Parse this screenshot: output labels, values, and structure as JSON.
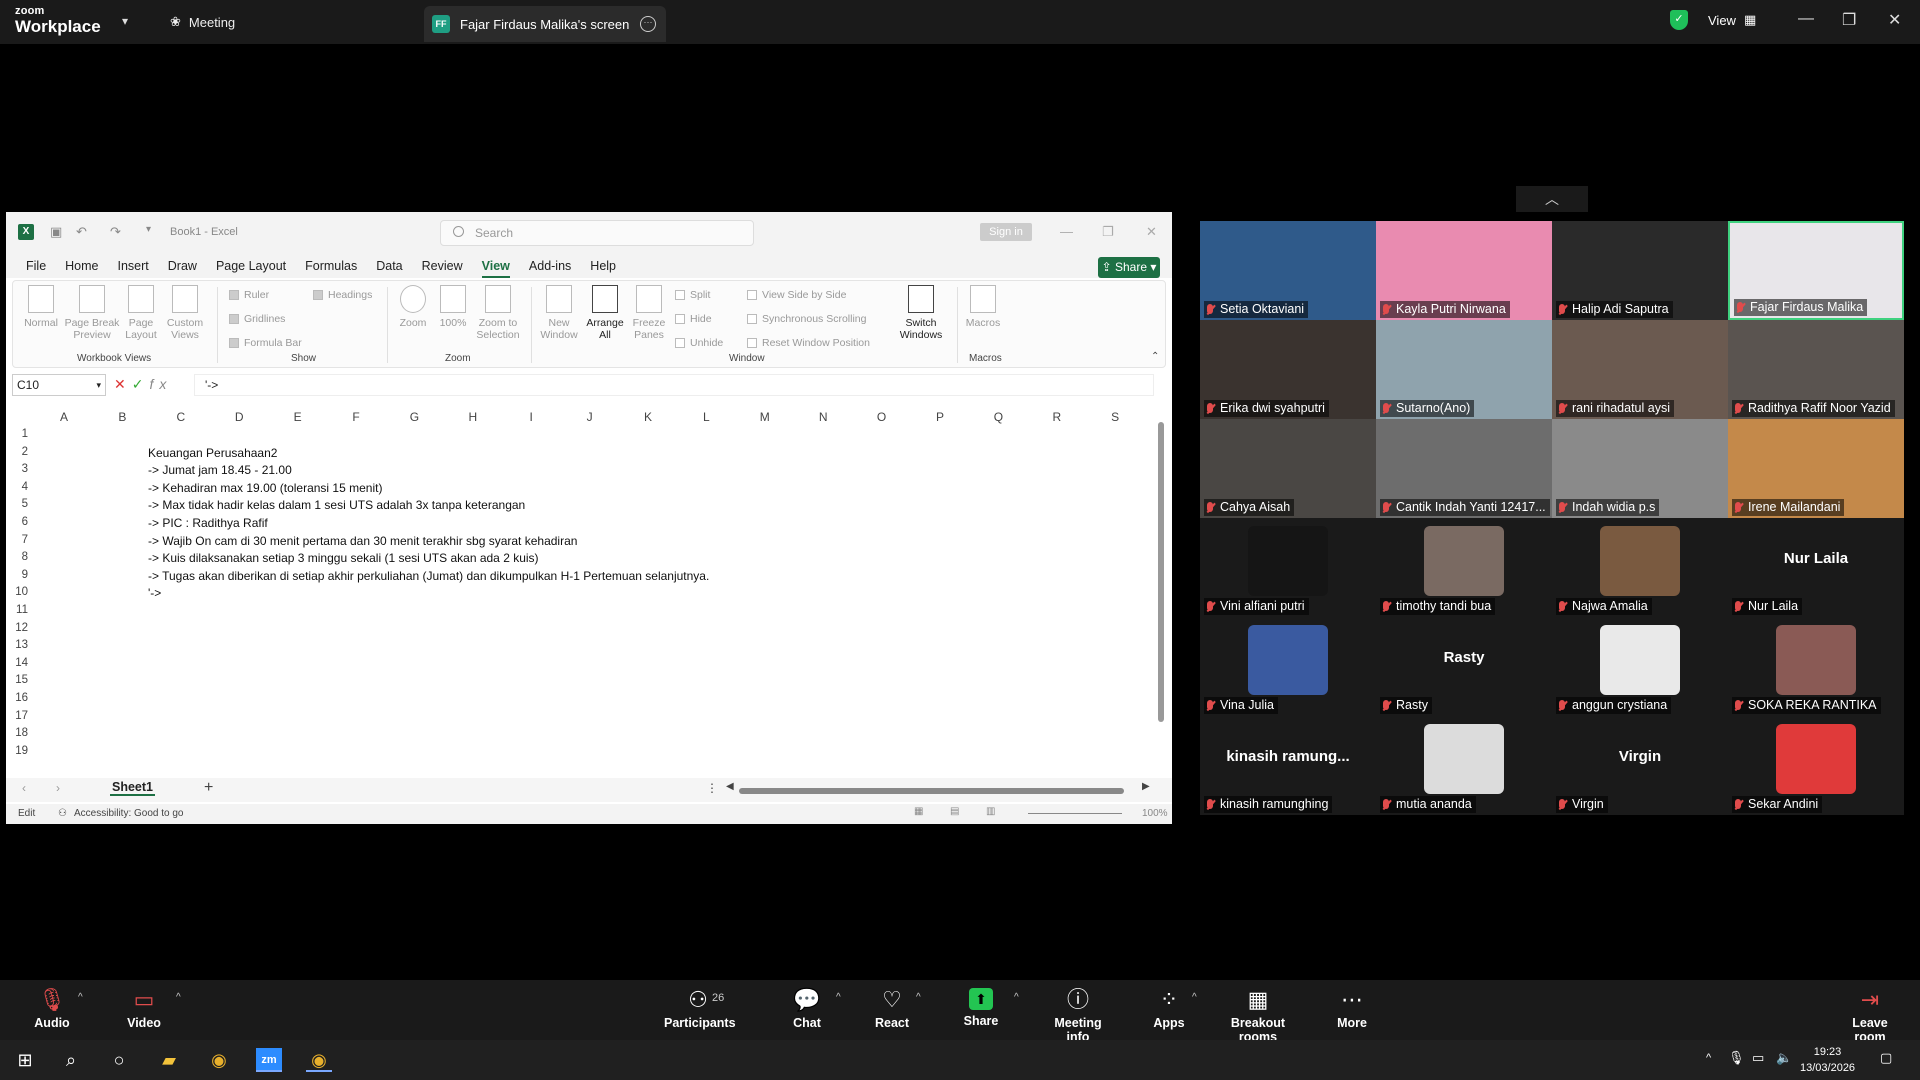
{
  "topbar": {
    "logo_top": "zoom",
    "logo_bottom": "Workplace",
    "meeting_label": "Meeting",
    "share_tab_initials": "FF",
    "share_tab_title": "Fajar Firdaus Malika's screen",
    "view_label": "View"
  },
  "excel": {
    "book_title": "Book1 - Excel",
    "search_placeholder": "Search",
    "sign_in": "Sign in",
    "share": "Share",
    "menu": [
      "File",
      "Home",
      "Insert",
      "Draw",
      "Page Layout",
      "Formulas",
      "Data",
      "Review",
      "View",
      "Add-ins",
      "Help"
    ],
    "active_menu": "View",
    "ribbon": {
      "normal": "Normal",
      "page_break": "Page Break Preview",
      "page_layout": "Page Layout",
      "custom_views": "Custom Views",
      "group_workbook_views": "Workbook Views",
      "ruler": "Ruler",
      "gridlines": "Gridlines",
      "formula_bar": "Formula Bar",
      "headings": "Headings",
      "group_show": "Show",
      "zoom": "Zoom",
      "zoom_100": "100%",
      "zoom_selection": "Zoom to Selection",
      "group_zoom": "Zoom",
      "new_window": "New Window",
      "arrange_all": "Arrange All",
      "freeze_panes": "Freeze Panes",
      "split": "Split",
      "hide": "Hide",
      "unhide": "Unhide",
      "side_by_side": "View Side by Side",
      "sync_scroll": "Synchronous Scrolling",
      "reset_window": "Reset Window Position",
      "switch_windows": "Switch Windows",
      "group_window": "Window",
      "macros": "Macros",
      "group_macros": "Macros"
    },
    "name_box": "C10",
    "formula": "'->",
    "columns": [
      "A",
      "B",
      "C",
      "D",
      "E",
      "F",
      "G",
      "H",
      "I",
      "J",
      "K",
      "L",
      "M",
      "N",
      "O",
      "P",
      "Q",
      "R",
      "S"
    ],
    "rows": [
      "1",
      "2",
      "3",
      "4",
      "5",
      "6",
      "7",
      "8",
      "9",
      "10",
      "11",
      "12",
      "13",
      "14",
      "15",
      "16",
      "17",
      "18",
      "19"
    ],
    "cells": [
      "",
      "Keuangan Perusahaan2",
      "-> Jumat jam 18.45 - 21.00",
      "-> Kehadiran max 19.00 (toleransi 15 menit)",
      "-> Max tidak hadir kelas dalam 1 sesi UTS adalah 3x tanpa keterangan",
      "-> PIC : Radithya Rafif",
      "-> Wajib On cam di 30 menit pertama dan 30 menit terakhir sbg syarat kehadiran",
      "-> Kuis dilaksanakan setiap 3 minggu sekali (1 sesi UTS akan ada 2 kuis)",
      "-> Tugas akan diberikan di setiap akhir perkuliahan (Jumat) dan dikumpulkan H-1 Pertemuan selanjutnya.",
      "'->"
    ],
    "sheet_tab": "Sheet1",
    "status_mode": "Edit",
    "accessibility": "Accessibility: Good to go",
    "zoom_level": "100%"
  },
  "participants": [
    {
      "name": "Setia Oktaviani",
      "color": "#2f5a8a"
    },
    {
      "name": "Kayla Putri Nirwana",
      "color": "#e98bb0"
    },
    {
      "name": "Halip Adi Saputra",
      "color": "#2a2a2a"
    },
    {
      "name": "Fajar Firdaus Malika",
      "color": "#e8e6ea"
    },
    {
      "name": "Erika dwi syahputri",
      "color": "#3a332f"
    },
    {
      "name": "Sutarno(Ano)",
      "color": "#8fa3ad"
    },
    {
      "name": "rani rihadatul aysi",
      "color": "#6b5a50"
    },
    {
      "name": "Radithya Rafif Noor Yazid",
      "color": "#5a5450"
    },
    {
      "name": "Cahya Aisah",
      "color": "#4a4744"
    },
    {
      "name": "Cantik Indah Yanti 12417...",
      "color": "#6d6d6d"
    },
    {
      "name": "Indah widia p.s",
      "color": "#8a8a8a"
    },
    {
      "name": "Irene Mailandani",
      "color": "#c4894a"
    },
    {
      "name": "Vini alfiani putri",
      "color": "#151515"
    },
    {
      "name": "timothy tandi bua",
      "color": "#7a6a62"
    },
    {
      "name": "Najwa Amalia",
      "color": "#7a5a40"
    },
    {
      "name": "Nur Laila",
      "color": "",
      "big": "Nur Laila"
    },
    {
      "name": "Vina Julia",
      "color": "#3a5aa0"
    },
    {
      "name": "Rasty",
      "color": "",
      "big": "Rasty"
    },
    {
      "name": "anggun crystiana",
      "color": "#e9e9e9"
    },
    {
      "name": "SOKA REKA RANTIKA",
      "color": "#8a5a55"
    },
    {
      "name": "kinasih ramunghing",
      "color": "",
      "big": "kinasih  ramung..."
    },
    {
      "name": "mutia ananda",
      "color": "#dcdcdc"
    },
    {
      "name": "Virgin",
      "color": "",
      "big": "Virgin"
    },
    {
      "name": "Sekar Andini",
      "color": "#e03a3a"
    }
  ],
  "toolbar": {
    "audio": "Audio",
    "video": "Video",
    "participants": "Participants",
    "participant_count": "26",
    "chat": "Chat",
    "react": "React",
    "share": "Share",
    "meeting_info": "Meeting info",
    "apps": "Apps",
    "breakout": "Breakout rooms",
    "more": "More",
    "leave": "Leave room"
  },
  "taskbar": {
    "time": "19:23",
    "date": "13/03/2026"
  },
  "colors": {
    "excel_green": "#1d7044",
    "zoom_share_green": "#23c552",
    "mute_red": "#e04c4c"
  }
}
